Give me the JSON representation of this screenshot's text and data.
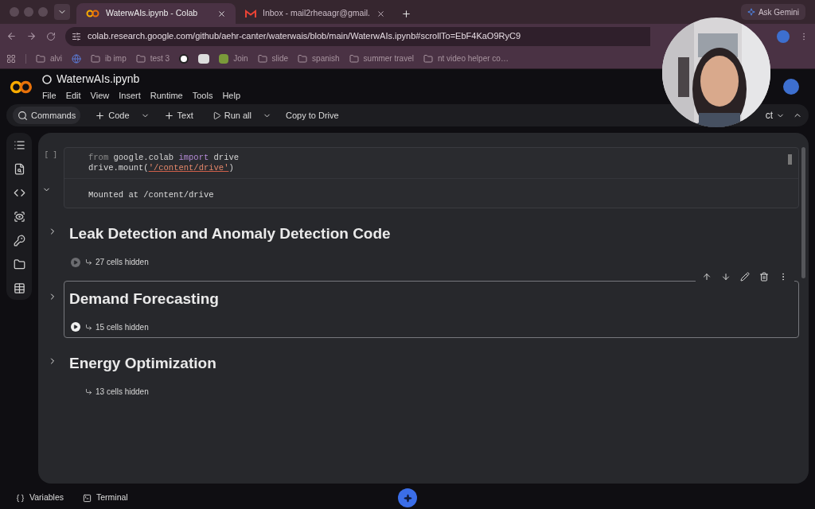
{
  "browser": {
    "tabs": [
      {
        "title": "WaterwAIs.ipynb - Colab",
        "kind": "colab",
        "selected": true
      },
      {
        "title": "Inbox - mail2rheaagr@gmail.",
        "kind": "mail",
        "selected": false
      }
    ],
    "ask_gemini": "Ask Gemini",
    "url": "colab.research.google.com/github/aehr-canter/waterwais/blob/main/WaterwAIs.ipynb#scrollTo=EbF4KaO9RyC9",
    "bookmarks": [
      {
        "label": "alvi",
        "kind": "folder"
      },
      {
        "kind": "globe"
      },
      {
        "label": "ib imp",
        "kind": "folder"
      },
      {
        "label": "test 3",
        "kind": "folder"
      },
      {
        "kind": "badge"
      },
      {
        "kind": "infinity"
      },
      {
        "label": "Join",
        "kind": "square"
      },
      {
        "label": "slide",
        "kind": "folder"
      },
      {
        "label": "spanish",
        "kind": "folder"
      },
      {
        "label": "summer travel",
        "kind": "folder"
      },
      {
        "label": "nt video helper co…",
        "kind": "folder"
      }
    ]
  },
  "notebook": {
    "title": "WaterwAIs.ipynb",
    "menu": [
      "File",
      "Edit",
      "View",
      "Insert",
      "Runtime",
      "Tools",
      "Help"
    ],
    "toolbar": [
      {
        "label": "Commands",
        "kind": "search"
      },
      {
        "label": "Code",
        "kind": "add-dropdown"
      },
      {
        "label": "Text",
        "kind": "add"
      },
      {
        "label": "Run all",
        "kind": "run-dropdown"
      },
      {
        "label": "Copy to Drive",
        "kind": "plain"
      }
    ],
    "connect_label": "ct"
  },
  "code_cell": {
    "exec_count": "[ ]",
    "lines": [
      [
        {
          "text": "from",
          "kind": "keyword"
        },
        {
          "text": " google.colab ",
          "kind": "plain"
        },
        {
          "text": "import",
          "kind": "import"
        },
        {
          "text": " drive",
          "kind": "plain"
        }
      ],
      [
        {
          "text": "drive.mount(",
          "kind": "plain"
        },
        {
          "text": "'/content/drive'",
          "kind": "string"
        },
        {
          "text": ")",
          "kind": "plain"
        }
      ]
    ],
    "output": "Mounted at /content/drive",
    "output_expanded": true
  },
  "sections": [
    {
      "title": "Leak Detection and Anomaly Detection Code",
      "hidden": "27 cells hidden",
      "run_button": true,
      "selected": false
    },
    {
      "title": "Demand Forecasting",
      "hidden": "15 cells hidden",
      "run_button": true,
      "selected": true
    },
    {
      "title": "Energy Optimization",
      "hidden": "13 cells hidden",
      "run_button": false,
      "selected": false
    }
  ],
  "status_bar": [
    {
      "label": "Variables",
      "kind": "braces"
    },
    {
      "label": "Terminal",
      "kind": "terminal"
    }
  ]
}
